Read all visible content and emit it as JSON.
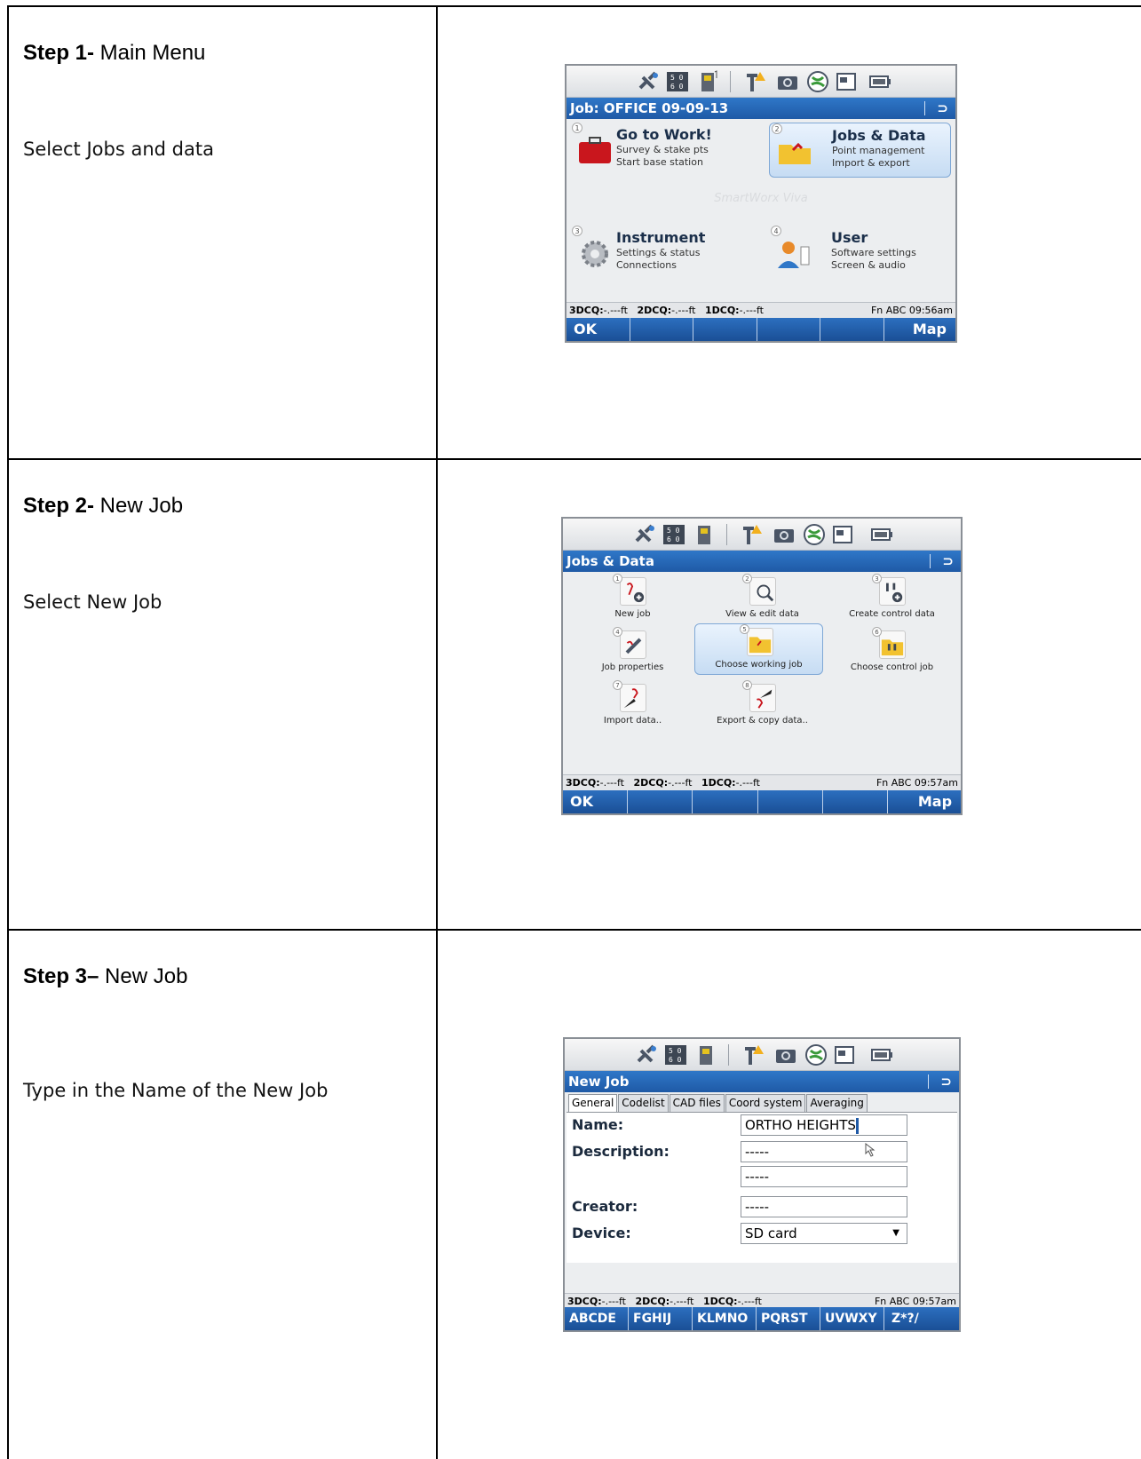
{
  "steps": [
    {
      "title_bold": "Step 1-",
      "title_rest": " Main Menu",
      "instruction": "Select Jobs and data",
      "screen": {
        "title": "Job: OFFICE 09-09-13",
        "back": "⊃",
        "tiles": [
          {
            "num": "1",
            "name": "Go to Work!",
            "line1": "Survey & stake pts",
            "line2": "Start base station"
          },
          {
            "num": "2",
            "name": "Jobs & Data",
            "line1": "Point management",
            "line2": "Import & export"
          },
          {
            "num": "3",
            "name": "Instrument",
            "line1": "Settings & status",
            "line2": "Connections"
          },
          {
            "num": "4",
            "name": "User",
            "line1": "Software settings",
            "line2": "Screen & audio"
          }
        ],
        "watermark": "SmartWorx Viva",
        "footer": {
          "q3": "3DCQ:",
          "v3": "-.---ft",
          "q2": "2DCQ:",
          "v2": "-.---ft",
          "q1": "1DCQ:",
          "v1": "-.---ft",
          "right": "Fn ABC 09:56am"
        },
        "softkeys": [
          "OK",
          "",
          "",
          "",
          "",
          "Map"
        ]
      }
    },
    {
      "title_bold": "Step 2-",
      "title_rest": " New Job",
      "instruction": "Select New Job",
      "screen": {
        "title": "Jobs & Data",
        "back": "⊃",
        "items": [
          {
            "num": "1",
            "label": "New job"
          },
          {
            "num": "2",
            "label": "View & edit data"
          },
          {
            "num": "3",
            "label": "Create control data"
          },
          {
            "num": "4",
            "label": "Job properties"
          },
          {
            "num": "5",
            "label": "Choose working job"
          },
          {
            "num": "6",
            "label": "Choose control job"
          },
          {
            "num": "7",
            "label": "Import data.."
          },
          {
            "num": "8",
            "label": "Export & copy data.."
          }
        ],
        "footer": {
          "q3": "3DCQ:",
          "v3": "-.---ft",
          "q2": "2DCQ:",
          "v2": "-.---ft",
          "q1": "1DCQ:",
          "v1": "-.---ft",
          "right": "Fn ABC 09:57am"
        },
        "softkeys": [
          "OK",
          "",
          "",
          "",
          "",
          "Map"
        ]
      }
    },
    {
      "title_bold": "Step 3–",
      "title_rest": " New Job",
      "instruction": "Type in the  Name of the New Job",
      "screen": {
        "title": "New Job",
        "back": "⊃",
        "tabs": [
          "General",
          "Codelist",
          "CAD files",
          "Coord system",
          "Averaging"
        ],
        "fields": {
          "name_label": "Name:",
          "name_value": "ORTHO HEIGHTS",
          "desc_label": "Description:",
          "desc_value1": "-----",
          "desc_value2": "-----",
          "creator_label": "Creator:",
          "creator_value": "-----",
          "device_label": "Device:",
          "device_value": "SD card"
        },
        "footer": {
          "q3": "3DCQ:",
          "v3": "-.---ft",
          "q2": "2DCQ:",
          "v2": "-.---ft",
          "q1": "1DCQ:",
          "v1": "-.---ft",
          "right": "Fn ABC 09:57am"
        },
        "softkeys": [
          "ABCDE",
          "FGHIJ",
          "KLMNO",
          "PQRST",
          "UVWXY",
          "Z*?/"
        ]
      }
    }
  ],
  "colors": {
    "titlebar": "#1f5aa6",
    "softkeys": "#1a4f96",
    "selection": "#c6dcf3",
    "border": "#000000"
  },
  "icons": [
    "satellite-icon",
    "memory-icon",
    "battery-sd-icon",
    "antenna-warning-icon",
    "camera-icon",
    "globe-icon",
    "window-icon",
    "battery-icon"
  ]
}
